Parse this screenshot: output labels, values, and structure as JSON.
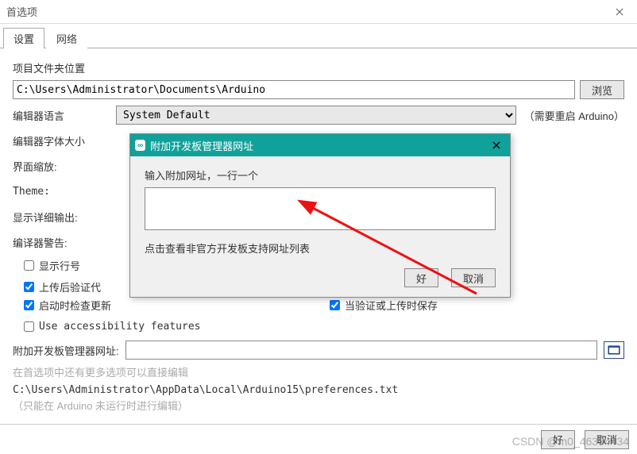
{
  "window_title": "首选项",
  "tabs": {
    "settings": "设置",
    "network": "网络"
  },
  "labels": {
    "folder_location": "项目文件夹位置",
    "editor_language": "编辑器语言",
    "editor_font_size": "编辑器字体大小",
    "interface_scale": "界面缩放:",
    "theme": "Theme:",
    "show_verbose": "显示详细输出:",
    "compiler_warnings": "编译器警告:",
    "additional_urls": "附加开发板管理器网址:"
  },
  "folder_path": "C:\\Users\\Administrator\\Documents\\Arduino",
  "browse_btn": "浏览",
  "language_value": "System Default",
  "restart_note": "（需要重启 Arduino）",
  "checkboxes": {
    "line_numbers": "显示行号",
    "verify_after_upload": "上传后验证代",
    "check_updates": "启动时检查更新",
    "save_on_verify": "当验证或上传时保存",
    "accessibility": "Use accessibility features"
  },
  "url_value": "",
  "prefs_more": "在首选项中还有更多选项可以直接编辑",
  "prefs_path": "C:\\Users\\Administrator\\AppData\\Local\\Arduino15\\preferences.txt",
  "prefs_note": "（只能在 Arduino 未运行时进行编辑）",
  "ok_btn": "好",
  "cancel_btn": "取消",
  "modal": {
    "title": "附加开发板管理器网址",
    "prompt": "输入附加网址，一行一个",
    "value": "",
    "link": "点击查看非官方开发板支持网址列表",
    "ok": "好",
    "cancel": "取消"
  },
  "watermark": "CSDN @m0_46334434"
}
